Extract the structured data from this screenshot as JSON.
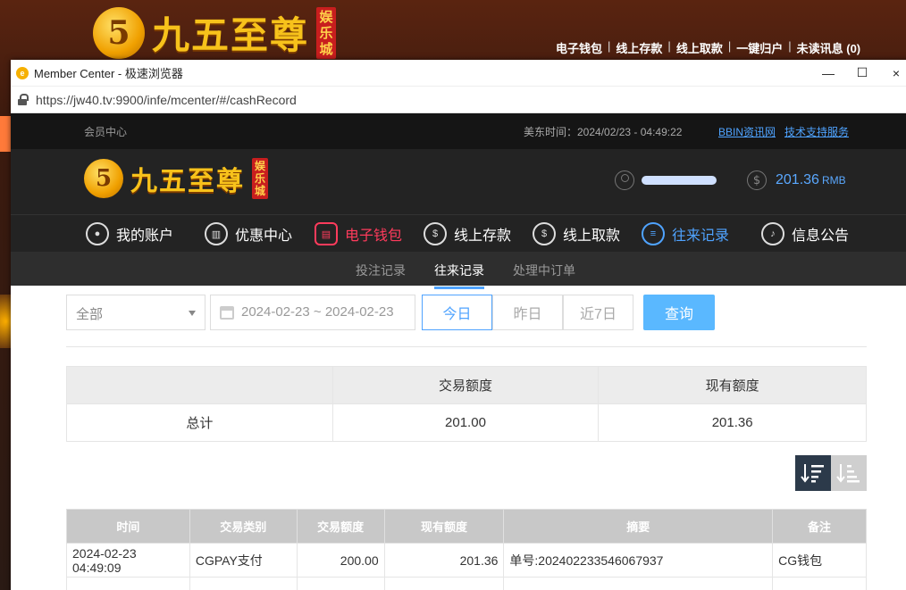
{
  "bg_site": {
    "logo_text": "九五至尊",
    "logo_seal": "娱乐城",
    "topnav": [
      "电子钱包",
      "线上存款",
      "线上取款",
      "一键归户",
      "未读讯息 (0)"
    ]
  },
  "window": {
    "title": "Member Center - 极速浏览器",
    "url": "https://jw40.tv:9900/infe/mcenter/#/cashRecord",
    "controls": {
      "minimize": "—",
      "maximize": "☐",
      "close": "×"
    }
  },
  "site": {
    "member_center": "会员中心",
    "us_time": "美东时间：2024/02/23 - 04:49:22",
    "link_bbin": "BBIN资讯网",
    "link_support": "技术支持服务",
    "logo_text": "九五至尊",
    "logo_seal": "娱乐城",
    "balance": "201.36",
    "currency": "RMB"
  },
  "nav": [
    {
      "label": "我的账户",
      "icon": "user-icon"
    },
    {
      "label": "优惠中心",
      "icon": "gift-icon"
    },
    {
      "label": "电子钱包",
      "icon": "wallet-icon"
    },
    {
      "label": "线上存款",
      "icon": "deposit-icon"
    },
    {
      "label": "线上取款",
      "icon": "withdraw-icon"
    },
    {
      "label": "往来记录",
      "icon": "record-icon"
    },
    {
      "label": "信息公告",
      "icon": "bell-icon"
    }
  ],
  "subnav": [
    "投注记录",
    "往来记录",
    "处理中订单"
  ],
  "filter": {
    "type_value": "全部",
    "date_range": "2024-02-23 ~ 2024-02-23",
    "today": "今日",
    "yesterday": "昨日",
    "last7": "近7日",
    "query": "查询"
  },
  "summary": {
    "headers": [
      "",
      "交易额度",
      "现有额度"
    ],
    "row": [
      "总计",
      "201.00",
      "201.36"
    ]
  },
  "records": {
    "headers": [
      "时间",
      "交易类别",
      "交易额度",
      "现有额度",
      "摘要",
      "备注"
    ],
    "rows": [
      [
        "2024-02-23 04:49:09",
        "CGPAY支付",
        "200.00",
        "201.36",
        "单号:202402233546067937",
        "CG钱包"
      ]
    ]
  },
  "colors": {
    "accent_blue": "#4fa3ff",
    "accent_red": "#ff3b5c",
    "query_btn": "#5ab8ff"
  }
}
